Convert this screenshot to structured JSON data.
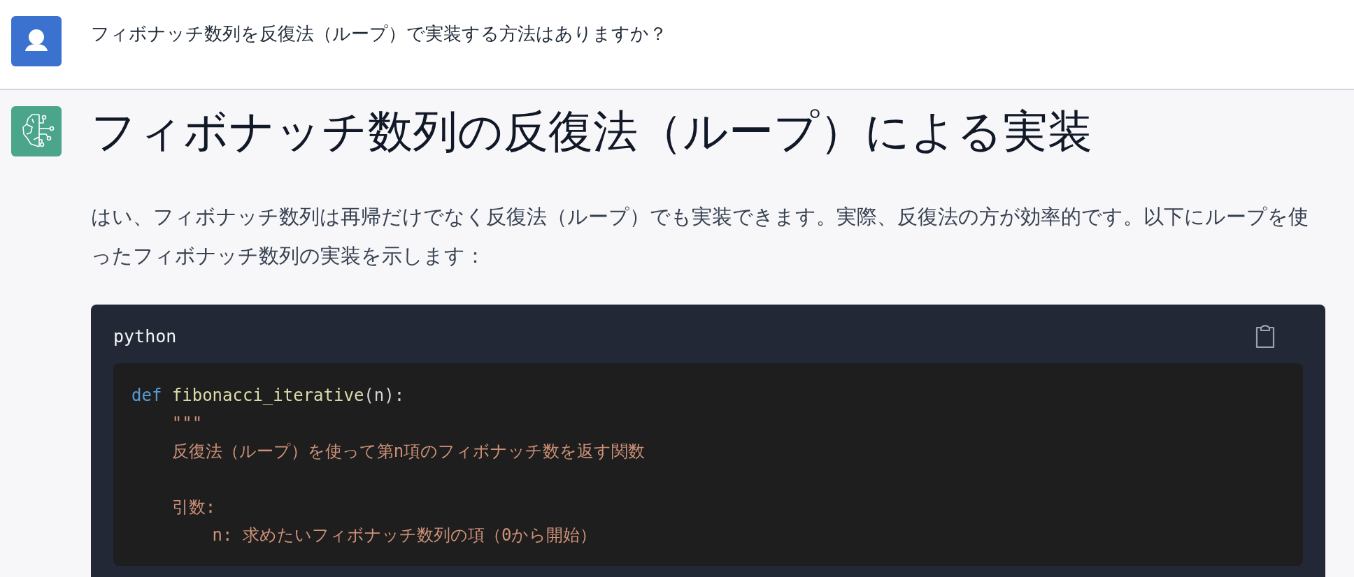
{
  "user_message": {
    "text": "フィボナッチ数列を反復法（ループ）で実装する方法はありますか？"
  },
  "assistant_message": {
    "heading": "フィボナッチ数列の反復法（ループ）による実装",
    "paragraph": "はい、フィボナッチ数列は再帰だけでなく反復法（ループ）でも実装できます。実際、反復法の方が効率的です。以下にループを使ったフィボナッチ数列の実装を示します：",
    "code_block": {
      "language": "python",
      "lines": [
        {
          "kind": "code",
          "tokens": [
            {
              "kind": "keyword",
              "text": "def"
            },
            {
              "kind": "function",
              "text": " fibonacci_iterative"
            },
            {
              "kind": "plain",
              "text": "(n):"
            }
          ]
        },
        {
          "kind": "code",
          "tokens": [
            {
              "kind": "string",
              "text": "    \"\"\""
            }
          ]
        },
        {
          "kind": "code",
          "tokens": [
            {
              "kind": "string",
              "text": "    反復法（ループ）を使って第n項のフィボナッチ数を返す関数"
            }
          ]
        },
        {
          "kind": "blank"
        },
        {
          "kind": "code",
          "tokens": [
            {
              "kind": "string",
              "text": "    引数:"
            }
          ]
        },
        {
          "kind": "code",
          "tokens": [
            {
              "kind": "string",
              "text": "        n: 求めたいフィボナッチ数列の項（0から開始）"
            }
          ]
        }
      ]
    }
  }
}
